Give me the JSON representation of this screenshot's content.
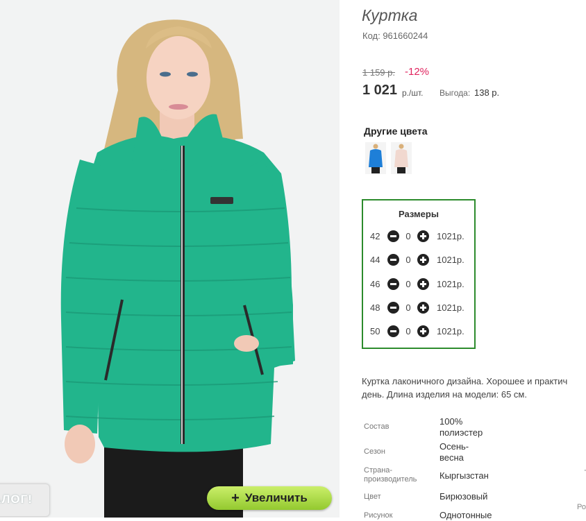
{
  "product": {
    "title": "Куртка",
    "code": "Код: 961660244",
    "old_price": "1 159 р.",
    "discount": "-12%",
    "price": "1 021",
    "unit": "р./шт.",
    "savings_label": "Выгода:",
    "savings_value": "138 р."
  },
  "photo": {
    "catalog_tab": "АЛОГ!",
    "zoom_button": "Увеличить",
    "jacket_color": "#22b58c"
  },
  "other_colors": {
    "title": "Другие цвета",
    "swatches": [
      "blue",
      "light-pink"
    ]
  },
  "sizes": {
    "title": "Размеры",
    "rows": [
      {
        "size": "42",
        "qty": "0",
        "price": "1021р."
      },
      {
        "size": "44",
        "qty": "0",
        "price": "1021р."
      },
      {
        "size": "46",
        "qty": "0",
        "price": "1021р."
      },
      {
        "size": "48",
        "qty": "0",
        "price": "1021р."
      },
      {
        "size": "50",
        "qty": "0",
        "price": "1021р."
      }
    ]
  },
  "description": {
    "line1": "Куртка лаконичного дизайна. Хорошее и практич",
    "line2": "день. Длина изделия на модели: 65 см."
  },
  "specs": {
    "composition_label": "Состав",
    "composition_value_1": "100%",
    "composition_value_2": "полиэстер",
    "season_label": "Сезон",
    "season_value_1": "Осень-",
    "season_value_2": "весна",
    "country_label_1": "Страна-",
    "country_label_2": "производитель",
    "country_value": "Кыргызстан",
    "color_label": "Цвет",
    "color_value": "Бирюзовый",
    "pattern_label": "Рисунок",
    "pattern_value": "Однотонные"
  },
  "edge": {
    "mark": "·",
    "ro": "Ро"
  },
  "colors": {
    "accent_green": "#2c8b2c",
    "discount_red": "#e0245e",
    "zoom_green": "#93c92f"
  }
}
